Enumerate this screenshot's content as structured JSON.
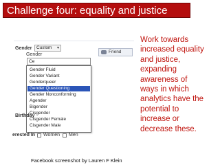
{
  "title": "Challenge four: equality and justice",
  "facebook_form": {
    "gender_label": "Gender",
    "gender_select_value": "Custom",
    "field_label": "Gender",
    "friends_button": "Friend",
    "typed_value": "Ce",
    "options": [
      "Gender Fluid",
      "Gender Variant",
      "Genderqueer",
      "Gender Questioning",
      "Gender Nonconforming",
      "Agender",
      "Bigender",
      "Cisgender",
      "Cisgender Female",
      "Cisgender Male"
    ],
    "selected_option": "Gender Questioning",
    "birthday_label": "Birthday",
    "interested_label": "erested In",
    "interested_options": [
      "Women",
      "Men"
    ]
  },
  "caption": "Facebook screenshot by Lauren F Klein",
  "body_lines": [
    "Work towards",
    "increased equality",
    "and justice,",
    "expanding",
    "awareness of",
    "ways in which",
    "analytics have the",
    "potential to",
    "increase or",
    "decrease these."
  ],
  "colors": {
    "title_bg": "#b40e0e",
    "body_text": "#c0150f",
    "selection": "#2b55b8"
  }
}
